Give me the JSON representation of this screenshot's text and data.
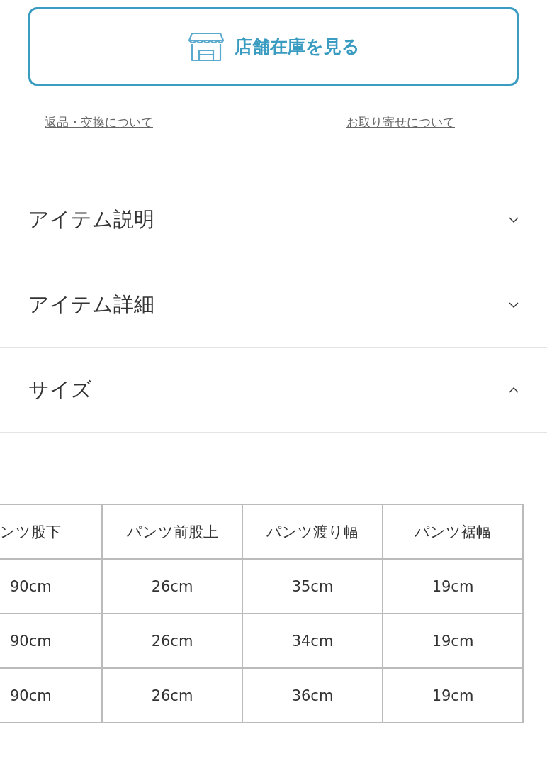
{
  "store_button": {
    "label": "店舗在庫を見る"
  },
  "links": [
    "返品・交換について",
    "お取り寄せについて"
  ],
  "sections": [
    {
      "title": "アイテム説明",
      "expanded": false
    },
    {
      "title": "アイテム詳細",
      "expanded": false
    },
    {
      "title": "サイズ",
      "expanded": true
    }
  ],
  "size_table": {
    "columns": [
      "ンツ股下",
      "パンツ前股上",
      "パンツ渡り幅",
      "パンツ裾幅"
    ],
    "rows": [
      [
        "90cm",
        "26cm",
        "35cm",
        "19cm"
      ],
      [
        "90cm",
        "26cm",
        "34cm",
        "19cm"
      ],
      [
        "90cm",
        "26cm",
        "36cm",
        "19cm"
      ]
    ]
  }
}
